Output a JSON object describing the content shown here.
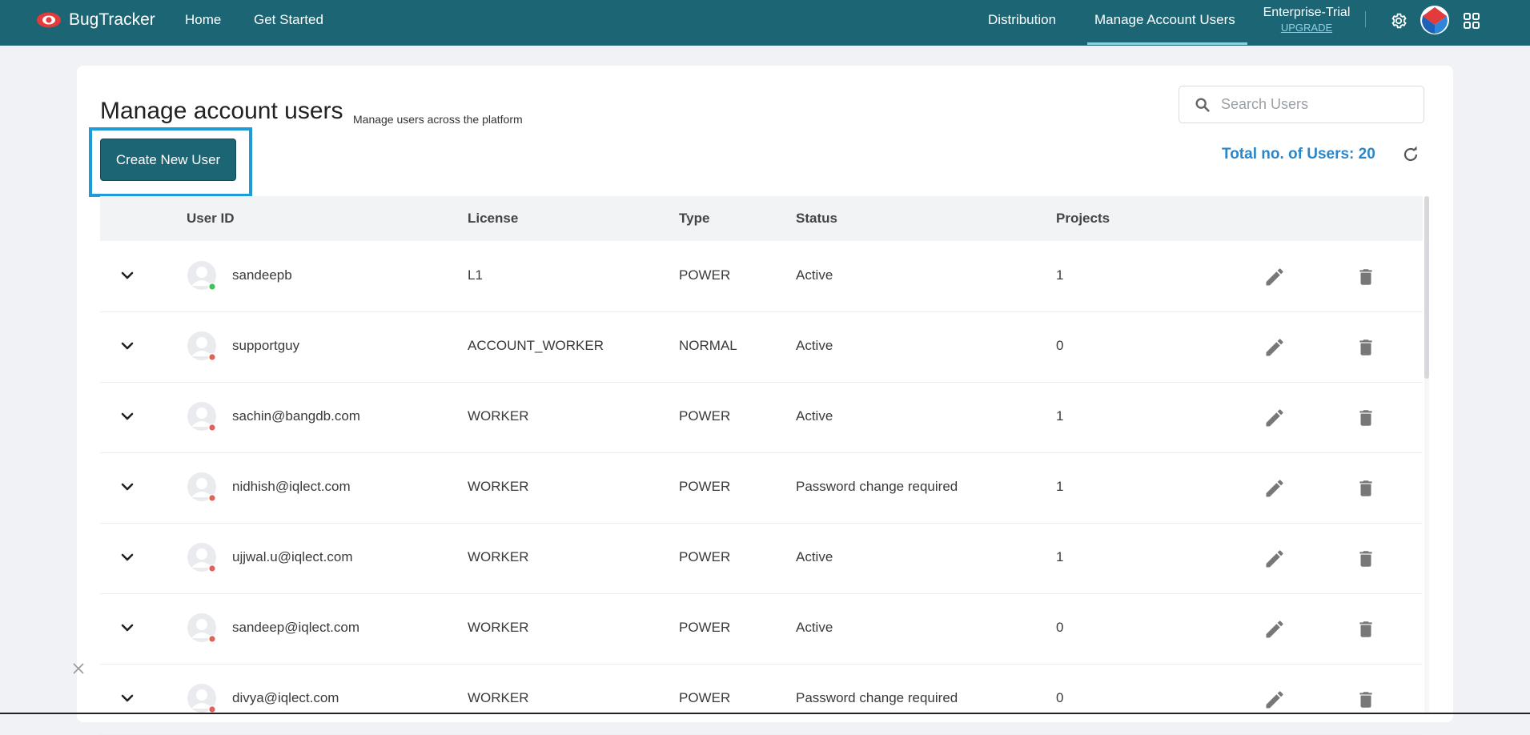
{
  "app": {
    "brand_name": "BugTracker",
    "nav_home": "Home",
    "nav_get_started": "Get Started",
    "nav_distribution": "Distribution",
    "nav_manage_users": "Manage Account Users",
    "plan_name": "Enterprise-Trial",
    "plan_upgrade": "UPGRADE",
    "colors": {
      "topbar": "#1b6574",
      "accent": "#2a86c9",
      "highlight": "#1f9bd7"
    }
  },
  "page": {
    "title": "Manage account users",
    "subtitle": "Manage users across the platform",
    "create_button": "Create New User",
    "search_placeholder": "Search Users",
    "total_users": "Total no. of Users: 20"
  },
  "table": {
    "headers": [
      "User ID",
      "License",
      "Type",
      "Status",
      "Projects"
    ],
    "rows": [
      {
        "user_id": "sandeepb",
        "license": "L1",
        "type": "POWER",
        "status": "Active",
        "projects": "1",
        "online": true
      },
      {
        "user_id": "supportguy",
        "license": "ACCOUNT_WORKER",
        "type": "NORMAL",
        "status": "Active",
        "projects": "0",
        "online": false
      },
      {
        "user_id": "sachin@bangdb.com",
        "license": "WORKER",
        "type": "POWER",
        "status": "Active",
        "projects": "1",
        "online": false
      },
      {
        "user_id": "nidhish@iqlect.com",
        "license": "WORKER",
        "type": "POWER",
        "status": "Password change required",
        "projects": "1",
        "online": false
      },
      {
        "user_id": "ujjwal.u@iqlect.com",
        "license": "WORKER",
        "type": "POWER",
        "status": "Active",
        "projects": "1",
        "online": false
      },
      {
        "user_id": "sandeep@iqlect.com",
        "license": "WORKER",
        "type": "POWER",
        "status": "Active",
        "projects": "0",
        "online": false
      },
      {
        "user_id": "divya@iqlect.com",
        "license": "WORKER",
        "type": "POWER",
        "status": "Password change required",
        "projects": "0",
        "online": false
      }
    ]
  },
  "icons": {
    "logo": "eye-logo-icon",
    "settings": "gear-icon",
    "avatar": "user-avatar-icon",
    "apps": "grid-icon",
    "search": "search-icon",
    "refresh": "refresh-icon",
    "expand": "chevron-down-icon",
    "edit": "pencil-icon",
    "delete": "trash-icon",
    "dismiss": "close-icon"
  }
}
